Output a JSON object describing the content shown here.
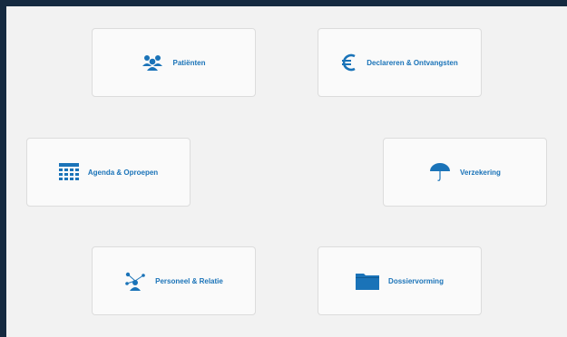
{
  "accent_color": "#1a73b8",
  "tiles": [
    {
      "label": "Patiënten",
      "icon": "patients-group-icon"
    },
    {
      "label": "Declareren & Ontvangsten",
      "icon": "euro-icon"
    },
    {
      "label": "Agenda & Oproepen",
      "icon": "calendar-grid-icon"
    },
    {
      "label": "Verzekering",
      "icon": "umbrella-icon"
    },
    {
      "label": "Personeel & Relatie",
      "icon": "network-person-icon"
    },
    {
      "label": "Dossiervorming",
      "icon": "folder-icon"
    }
  ]
}
